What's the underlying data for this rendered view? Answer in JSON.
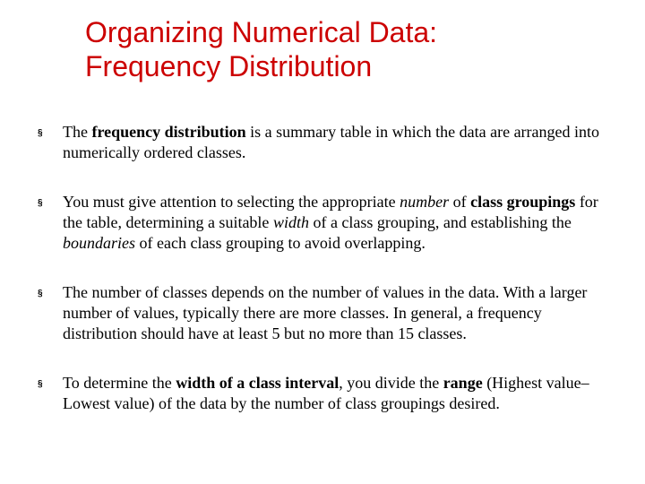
{
  "title_line1": "Organizing Numerical Data:",
  "title_line2": "Frequency Distribution",
  "bullets": {
    "b1": {
      "t1": "The ",
      "t2": "frequency distribution",
      "t3": " is a summary table in which the data are arranged into numerically ordered classes."
    },
    "b2": {
      "t1": "You must give attention to selecting the appropriate ",
      "t2": "number",
      "t3": " of ",
      "t4": "class groupings",
      "t5": " for the table, determining a suitable ",
      "t6": "width",
      "t7": " of a class grouping, and establishing the ",
      "t8": "boundaries",
      "t9": " of each class grouping to avoid overlapping."
    },
    "b3": {
      "t1": "The number of classes depends on the number of values in the data.  With a larger number of values, typically there are more classes.  In general, a frequency distribution should have at least 5 but no more than 15 classes."
    },
    "b4": {
      "t1": "To determine the ",
      "t2": "width of a class interval",
      "t3": ", you divide the ",
      "t4": "range",
      "t5": " (Highest value–Lowest value) of the data by the number of class groupings desired."
    }
  },
  "marker": "§"
}
